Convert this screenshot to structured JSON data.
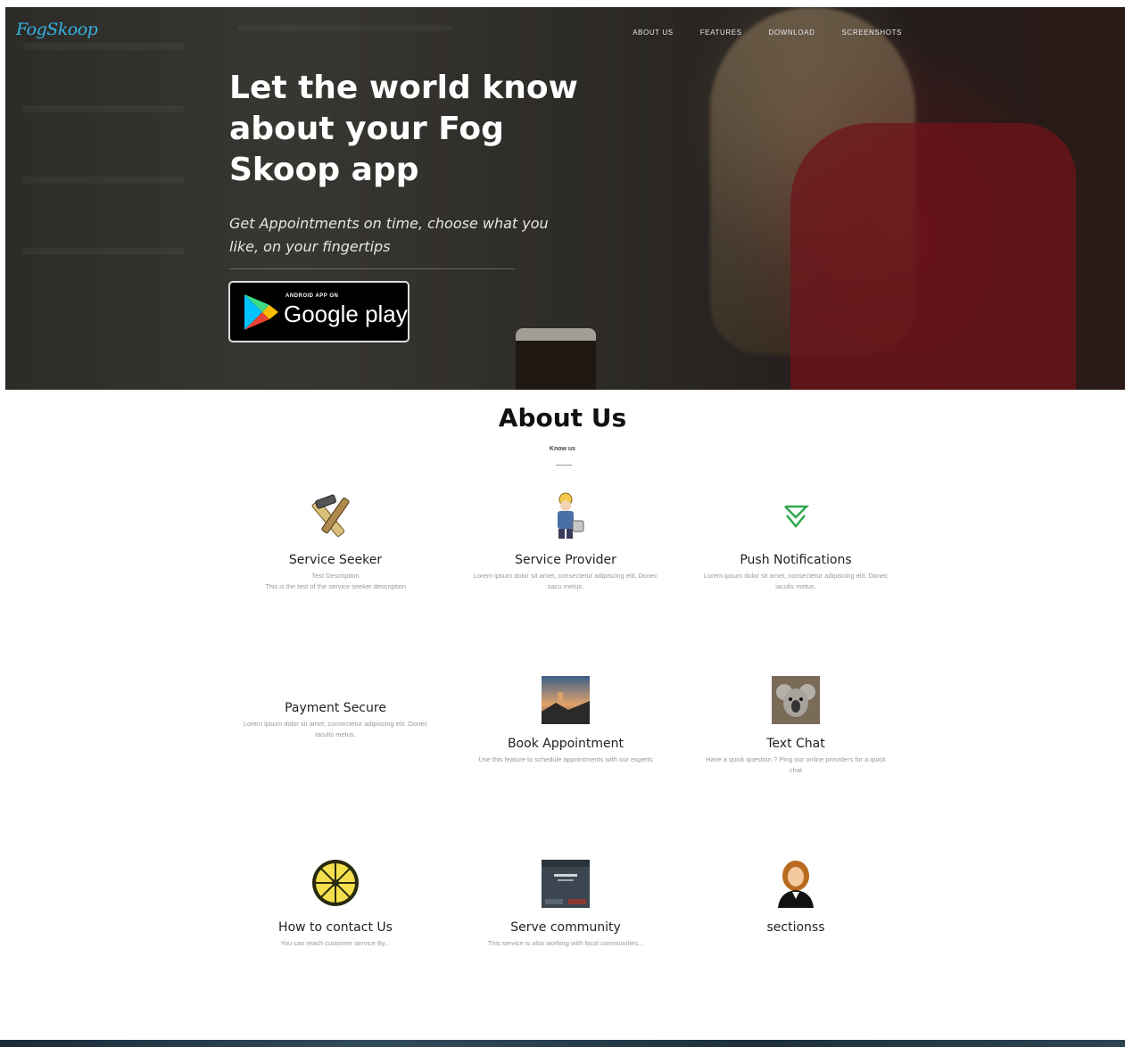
{
  "brand": {
    "logo_text": "FogSkoop",
    "accent_color": "#35b3e4"
  },
  "nav": {
    "items": [
      "ABOUT US",
      "FEATURES",
      "DOWNLOAD",
      "SCREENSHOTS"
    ]
  },
  "hero": {
    "title": "Let the world know about your Fog Skoop app",
    "subtitle": "Get Appointments on time, choose what you like, on your fingertips",
    "store_button": {
      "small_text": "ANDROID APP ON",
      "big_text": "Google play"
    }
  },
  "about": {
    "title": "About Us",
    "subtitle": "Know us",
    "features": [
      {
        "icon": "hammer-saw-icon",
        "title": "Service Seeker",
        "desc": "Test Description\nThis is the test of the service seeker description"
      },
      {
        "icon": "worker-icon",
        "title": "Service Provider",
        "desc": "Lorem ipsum dolor sit amet, consectetur adipiscing elit. Donec sacu metus."
      },
      {
        "icon": "chevron-down-icon",
        "title": "Push Notifications",
        "desc": "Lorem ipsum dolor sit amet, consectetur adipiscing elit. Donec iaculis metus."
      },
      {
        "icon": "",
        "title": "Payment Secure",
        "desc": "Lorem ipsum dolor sit amet, consectetur adipiscing elit. Donec iaculis metus."
      },
      {
        "icon": "landscape-photo-icon",
        "title": "Book Appointment",
        "desc": "Use this feature to schedule appointments with our experts"
      },
      {
        "icon": "koala-photo-icon",
        "title": "Text Chat",
        "desc": "Have a quick question ? Ping our online providers for a quick chat"
      },
      {
        "icon": "lemon-slice-icon",
        "title": "How to contact Us",
        "desc": "You can reach customer service By..."
      },
      {
        "icon": "screenshot-thumbnail-icon",
        "title": "Serve community",
        "desc": "This service is also working with local communities..."
      },
      {
        "icon": "person-avatar-icon",
        "title": "sectionss",
        "desc": ""
      }
    ]
  },
  "colors": {
    "nav_text": "#e8e8e8",
    "notification_green": "#2fa84f",
    "dress_red": "#961923"
  }
}
